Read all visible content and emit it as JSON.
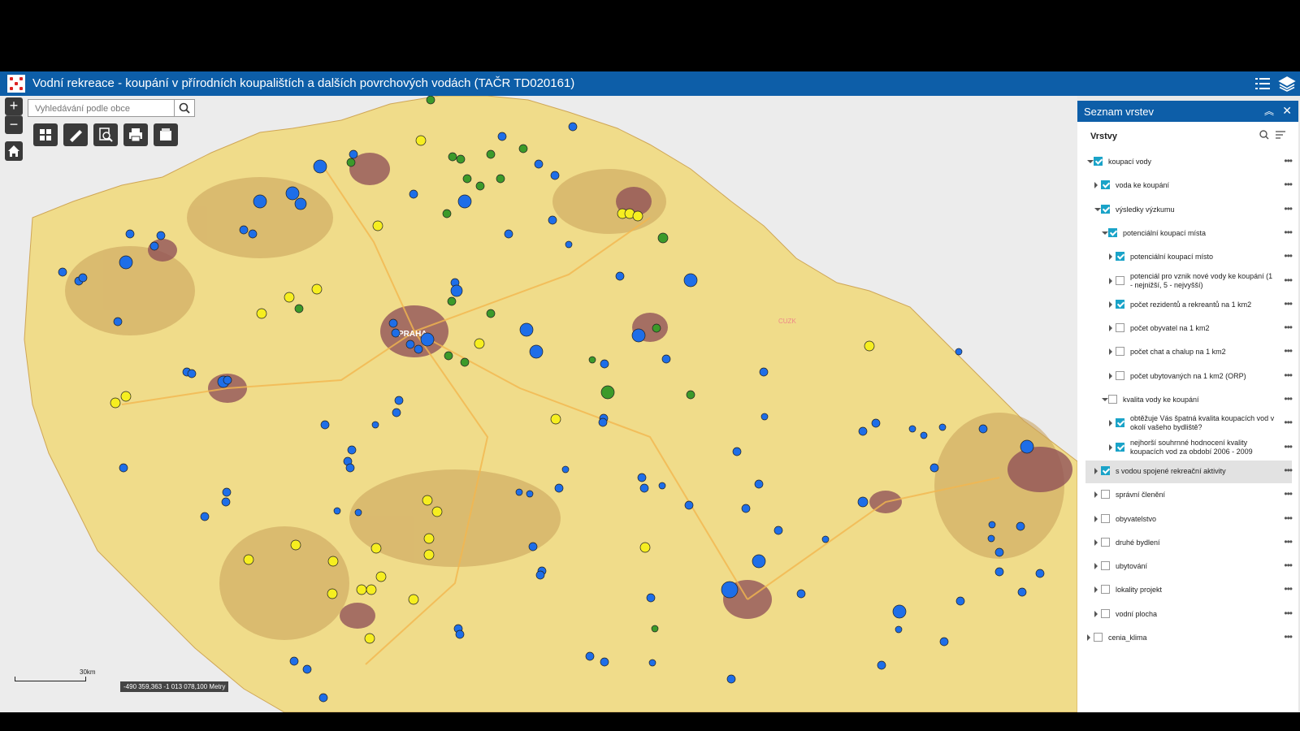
{
  "app": {
    "title": "Vodní rekreace - koupání v přírodních koupalištích a dalších povrchových vodách (TAČR TD020161)",
    "header_icons": [
      "list-icon",
      "layers-icon"
    ]
  },
  "map": {
    "zoom_in": "+",
    "zoom_out": "−",
    "search_placeholder": "Vyhledávání podle obce",
    "tools": [
      "grid-icon",
      "measure-icon",
      "zoom-search-icon",
      "print-icon",
      "basemap-icon"
    ],
    "scale_label": "30km",
    "coordinates": "-490 359,363 -1 013 078,100 Metry",
    "city_label": "PRAHA",
    "watermark": "CUZK",
    "colors": {
      "green": "#3c9a2a",
      "yellow": "#f6ee20",
      "blue": "#1e6ee8",
      "base": "#f0dc8a",
      "urban": "#8c4b55"
    }
  },
  "panel": {
    "title": "Seznam vrstev",
    "layers_label": "Vrstvy",
    "layers": [
      {
        "label": "koupací vody",
        "checked": true,
        "expand": "open",
        "indent": 0
      },
      {
        "label": "voda ke koupání",
        "checked": true,
        "expand": "closed",
        "indent": 1
      },
      {
        "label": "výsledky výzkumu",
        "checked": true,
        "expand": "open",
        "indent": 1
      },
      {
        "label": "potenciální koupací místa",
        "checked": true,
        "expand": "open",
        "indent": 2
      },
      {
        "label": "potenciální koupací místo",
        "checked": true,
        "expand": "closed",
        "indent": 3
      },
      {
        "label": "potenciál pro vznik nové vody ke koupání (1 - nejnižší, 5 - nejvyšší)",
        "checked": false,
        "expand": "closed",
        "indent": 3
      },
      {
        "label": "počet rezidentů a rekreantů na 1 km2",
        "checked": true,
        "expand": "closed",
        "indent": 3
      },
      {
        "label": "počet obyvatel na 1 km2",
        "checked": false,
        "expand": "closed",
        "indent": 3
      },
      {
        "label": "počet chat a chalup na 1 km2",
        "checked": false,
        "expand": "closed",
        "indent": 3
      },
      {
        "label": "počet ubytovaných na 1 km2 (ORP)",
        "checked": false,
        "expand": "closed",
        "indent": 3
      },
      {
        "label": "kvalita vody ke koupání",
        "checked": false,
        "expand": "open",
        "indent": 2
      },
      {
        "label": "obtěžuje Vás špatná kvalita koupacích vod v okolí vašeho bydliště?",
        "checked": true,
        "expand": "closed",
        "indent": 3
      },
      {
        "label": "nejhorší souhrnné hodnocení kvality koupacích vod za období 2006 - 2009",
        "checked": true,
        "expand": "closed",
        "indent": 3
      },
      {
        "label": "s vodou spojené rekreační aktivity",
        "checked": true,
        "expand": "closed",
        "indent": 1,
        "selected": true
      },
      {
        "label": "správní členění",
        "checked": false,
        "expand": "closed",
        "indent": 1
      },
      {
        "label": "obyvatelstvo",
        "checked": false,
        "expand": "closed",
        "indent": 1
      },
      {
        "label": "druhé bydlení",
        "checked": false,
        "expand": "closed",
        "indent": 1
      },
      {
        "label": "ubytování",
        "checked": false,
        "expand": "closed",
        "indent": 1
      },
      {
        "label": "lokality projekt",
        "checked": false,
        "expand": "closed",
        "indent": 1
      },
      {
        "label": "vodní plocha",
        "checked": false,
        "expand": "closed",
        "indent": 1
      },
      {
        "label": "cenia_klima",
        "checked": false,
        "expand": "closed",
        "indent": 0
      }
    ]
  }
}
